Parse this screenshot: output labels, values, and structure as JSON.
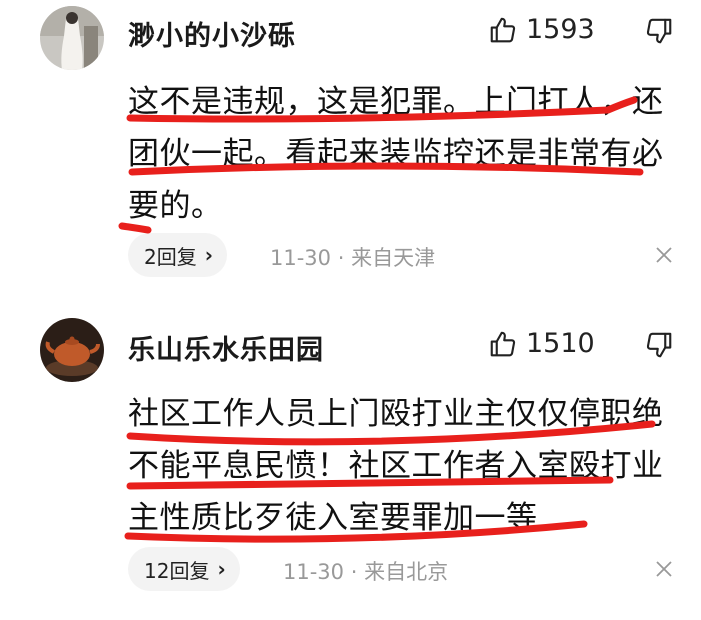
{
  "comments": [
    {
      "username": "渺小的小沙砾",
      "likes": "1593",
      "lines": [
        "这不是违规，这是犯罪。上门打人，还",
        "团伙一起。看起来装监控还是非常有必",
        "要的。"
      ],
      "reply_label": "2回复",
      "date": "11-30",
      "separator": "·",
      "location": "来自天津"
    },
    {
      "username": "乐山乐水乐田园",
      "likes": "1510",
      "lines": [
        "社区工作人员上门殴打业主仅仅停职绝",
        "不能平息民愤！社区工作者入室殴打业",
        "主性质比歹徒入室要罪加一等"
      ],
      "reply_label": "12回复",
      "date": "11-30",
      "separator": "·",
      "location": "来自北京"
    }
  ],
  "icons": {
    "like": "thumbs-up-icon",
    "dislike": "thumbs-down-icon",
    "close": "close-icon",
    "chevron": "chevron-right-icon"
  },
  "colors": {
    "annotation": "#e8201c",
    "meta_text": "#999999",
    "pill_bg": "#f3f3f3"
  }
}
